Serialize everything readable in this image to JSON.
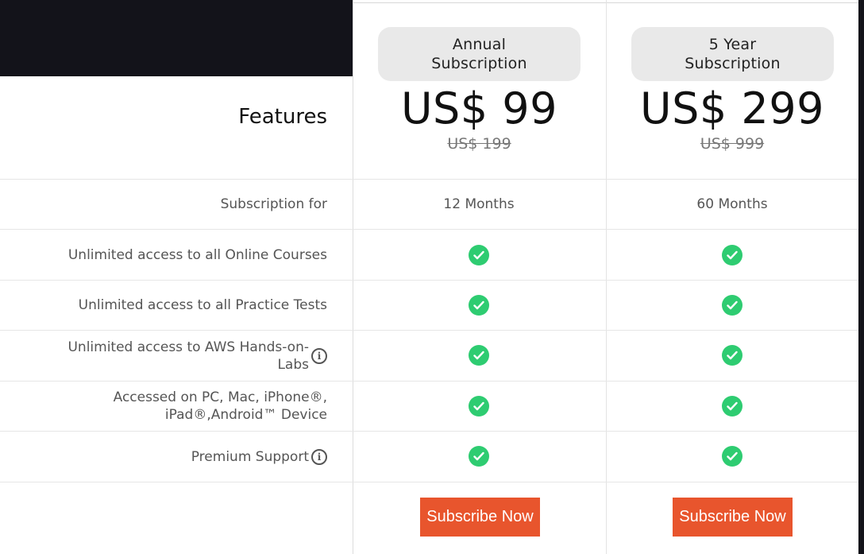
{
  "features_heading": "Features",
  "plans": [
    {
      "name": "Annual\nSubscription",
      "price": "US$ 99",
      "old_price": "US$ 199",
      "duration": "12 Months",
      "button_label": "Subscribe Now"
    },
    {
      "name": "5 Year\nSubscription",
      "price": "US$ 299",
      "old_price": "US$ 999",
      "duration": "60 Months",
      "button_label": "Subscribe Now"
    }
  ],
  "features": [
    {
      "label": "Subscription for"
    },
    {
      "label": "Unlimited access to all Online Courses"
    },
    {
      "label": "Unlimited access to all Practice Tests"
    },
    {
      "label": "Unlimited access to AWS Hands-on-\nLabs",
      "info_icon": "info-icon"
    },
    {
      "label": "Accessed on PC, Mac, iPhone®,\niPad®,Android™ Device"
    },
    {
      "label": "Premium Support",
      "info_icon": "info-icon"
    }
  ],
  "included_icon": "check-circle-icon",
  "colors": {
    "accent": "#e8552d",
    "check": "#2ecc71",
    "dark_band": "#13131a",
    "pill": "#e9e9e9"
  }
}
